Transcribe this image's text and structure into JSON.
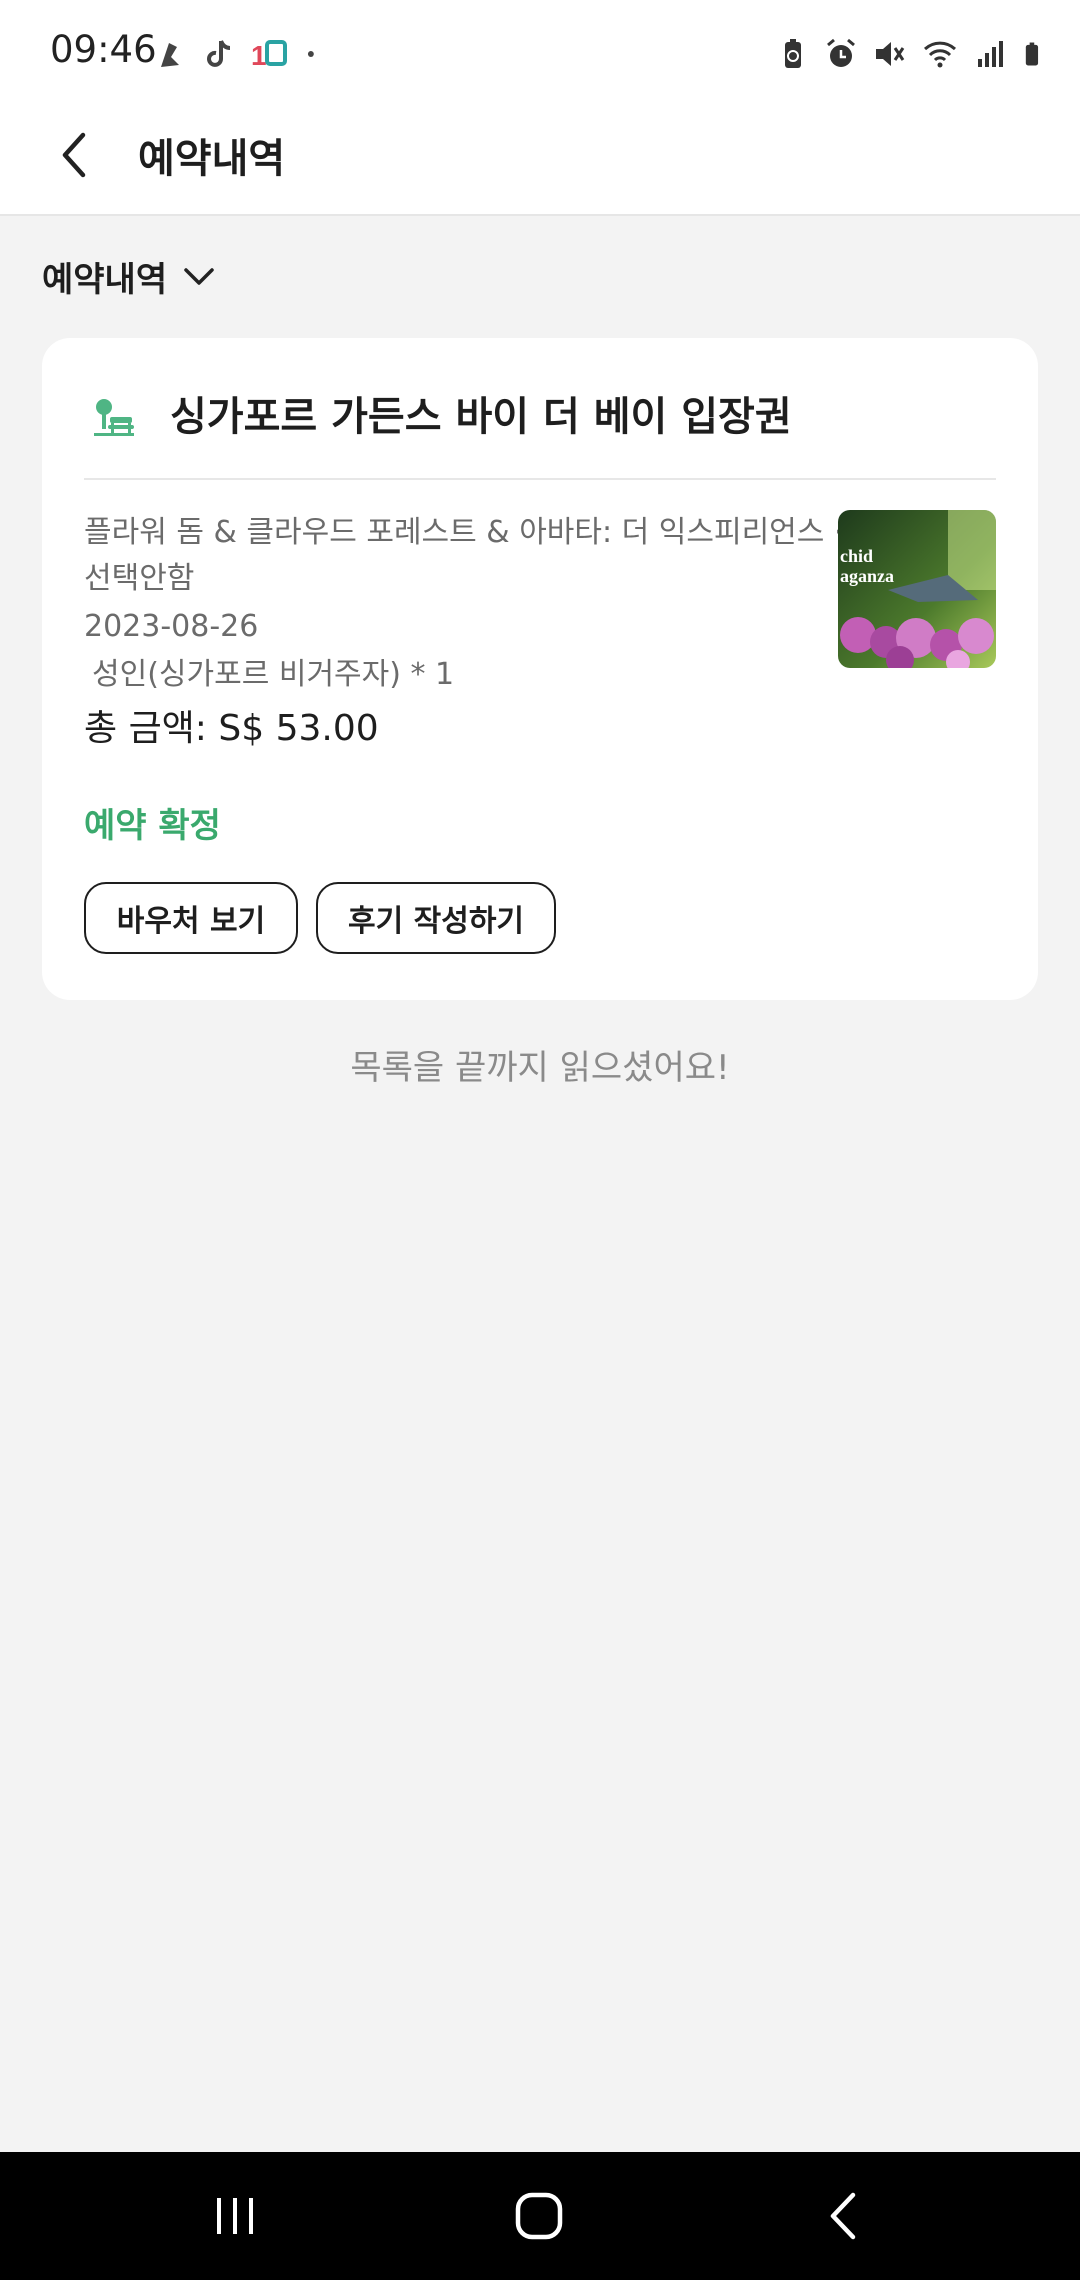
{
  "status_bar": {
    "time": "09:46",
    "left_icons": [
      "music-app-icon",
      "tiktok-icon",
      "one-q-app-icon",
      "dot-icon"
    ],
    "right_icons": [
      "battery-saver-icon",
      "alarm-icon",
      "mute-icon",
      "wifi-icon",
      "signal-icon",
      "battery-icon"
    ]
  },
  "header": {
    "title": "예약내역",
    "back_icon": "chevron-left-icon"
  },
  "filter": {
    "label": "예약내역",
    "icon": "chevron-down-icon"
  },
  "booking": {
    "category_icon": "park-icon",
    "title": "싱가포르 가든스 바이 더 베이 입장권",
    "description": "플라워 돔 & 클라우드 포레스트 & 아바타: 더 익스피리언스 · 선택안함",
    "date": "2023-08-26",
    "quantity": "성인(싱가포르 비거주자) * 1",
    "total": "총 금액: S$ 53.00",
    "status": "예약 확정",
    "status_color": "#3aa96d",
    "thumbnail_text": "chid\naganza",
    "buttons": {
      "voucher": "바우처 보기",
      "review": "후기 작성하기"
    }
  },
  "list_end_message": "목록을 끝까지 읽으셨어요!",
  "nav_bar": {
    "icons": [
      "recent-apps-icon",
      "home-icon",
      "back-icon"
    ]
  }
}
